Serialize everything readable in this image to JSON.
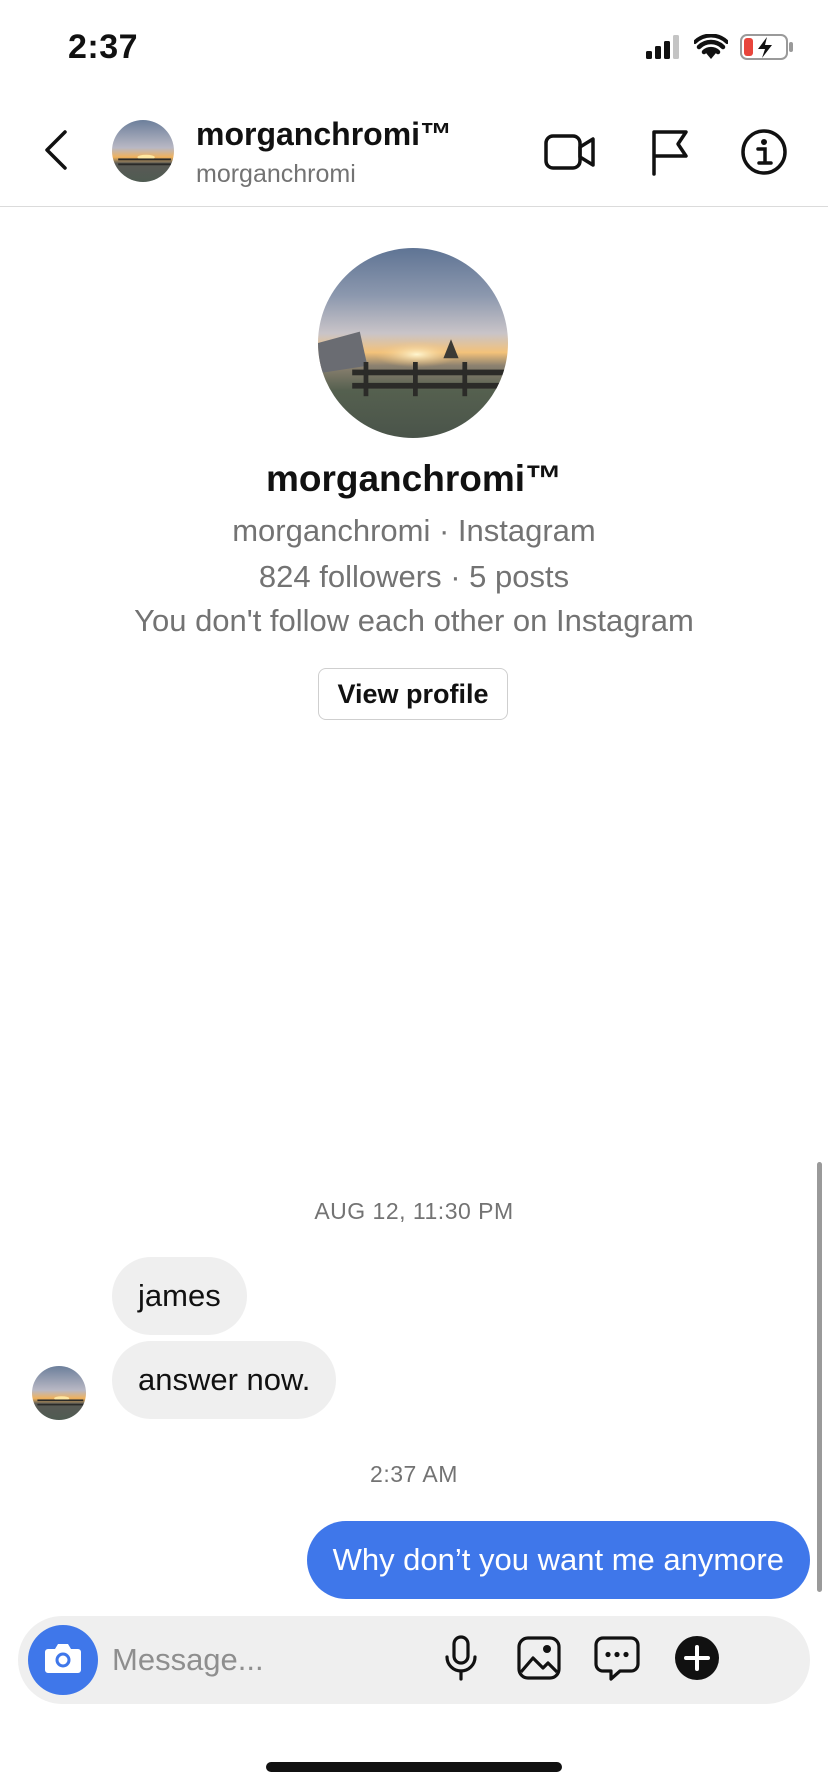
{
  "status_bar": {
    "time": "2:37",
    "battery_color": "#e8453c"
  },
  "header": {
    "display_name": "morganchromi™",
    "username": "morganchromi",
    "icons": [
      "back-chevron-icon",
      "video-camera-icon",
      "flag-icon",
      "info-icon"
    ]
  },
  "profile": {
    "display_name": "morganchromi™",
    "source_line": "morganchromi · Instagram",
    "stats_line": "824 followers · 5 posts",
    "follow_status": "You don't follow each other on Instagram",
    "view_profile_label": "View profile"
  },
  "messages": {
    "timestamp_1": "AUG 12, 11:30 PM",
    "incoming_1": "james",
    "incoming_2": "answer now.",
    "timestamp_2": "2:37 AM",
    "outgoing_1": "Why don’t you want me anymore"
  },
  "composer": {
    "placeholder": "Message...",
    "icons": [
      "camera-icon",
      "microphone-icon",
      "gallery-icon",
      "sticker-chat-icon",
      "add-icon"
    ]
  },
  "colors": {
    "accent": "#3f77ea",
    "incoming_bubble": "#efefef",
    "secondary_text": "#737373"
  }
}
